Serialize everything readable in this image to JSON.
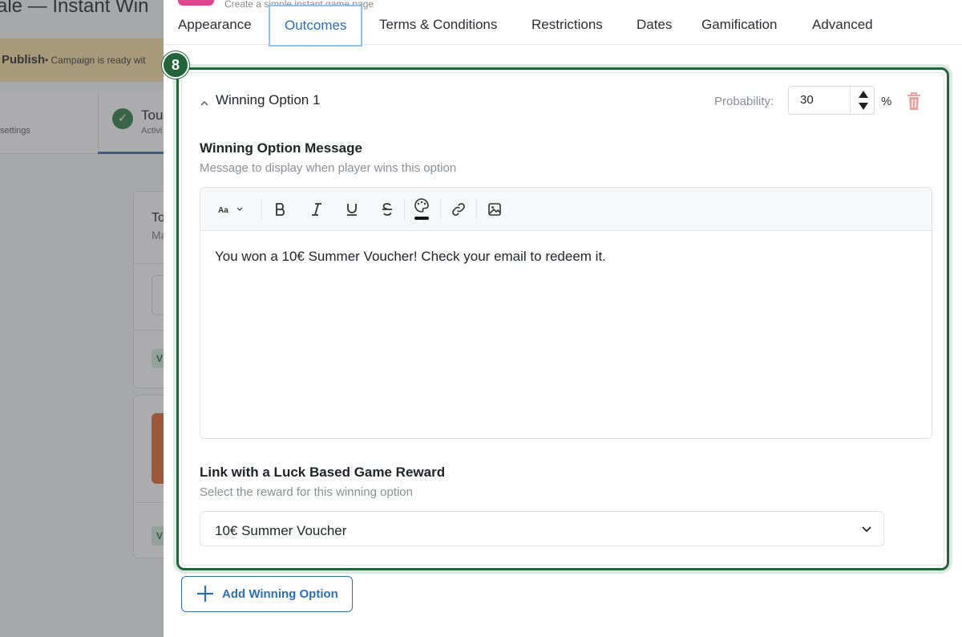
{
  "background": {
    "title": "ale — Instant Win",
    "banner": {
      "label": "Publish",
      "text": "• Campaign is ready wit"
    },
    "step_tab": {
      "settings": "settings",
      "title": "Tou",
      "subtitle": "Activi"
    },
    "card1": {
      "title": "To",
      "sub": "Ma",
      "tag": "V"
    },
    "card2": {
      "tag": "V"
    }
  },
  "drawer": {
    "subtitle": "Create a simple instant game page",
    "tabs": [
      {
        "label": "Appearance"
      },
      {
        "label": "Outcomes",
        "active": true
      },
      {
        "label": "Terms & Conditions"
      },
      {
        "label": "Restrictions"
      },
      {
        "label": "Dates"
      },
      {
        "label": "Gamification"
      },
      {
        "label": "Advanced"
      }
    ],
    "step_badge": "8",
    "option": {
      "title": "Winning Option 1",
      "probability_label": "Probability:",
      "probability_value": "30",
      "percent": "%",
      "message_title": "Winning Option Message",
      "message_sub": "Message to display when player wins this option",
      "editor_text": "You won a 10€ Summer Voucher! Check your email to redeem it.",
      "toolbar": [
        "font-size-icon",
        "bold-icon",
        "italic-icon",
        "underline-icon",
        "strikethrough-icon",
        "text-color-icon",
        "link-icon",
        "image-icon"
      ],
      "reward_title": "Link with a Luck Based Game Reward",
      "reward_sub": "Select the reward for this winning option",
      "reward_value": "10€ Summer Voucher"
    },
    "add_button": "Add Winning Option"
  },
  "colors": {
    "accent": "#2f6db3",
    "highlight": "#23633a",
    "trash": "#e8a3a3",
    "banner": "#f7dfa3"
  }
}
